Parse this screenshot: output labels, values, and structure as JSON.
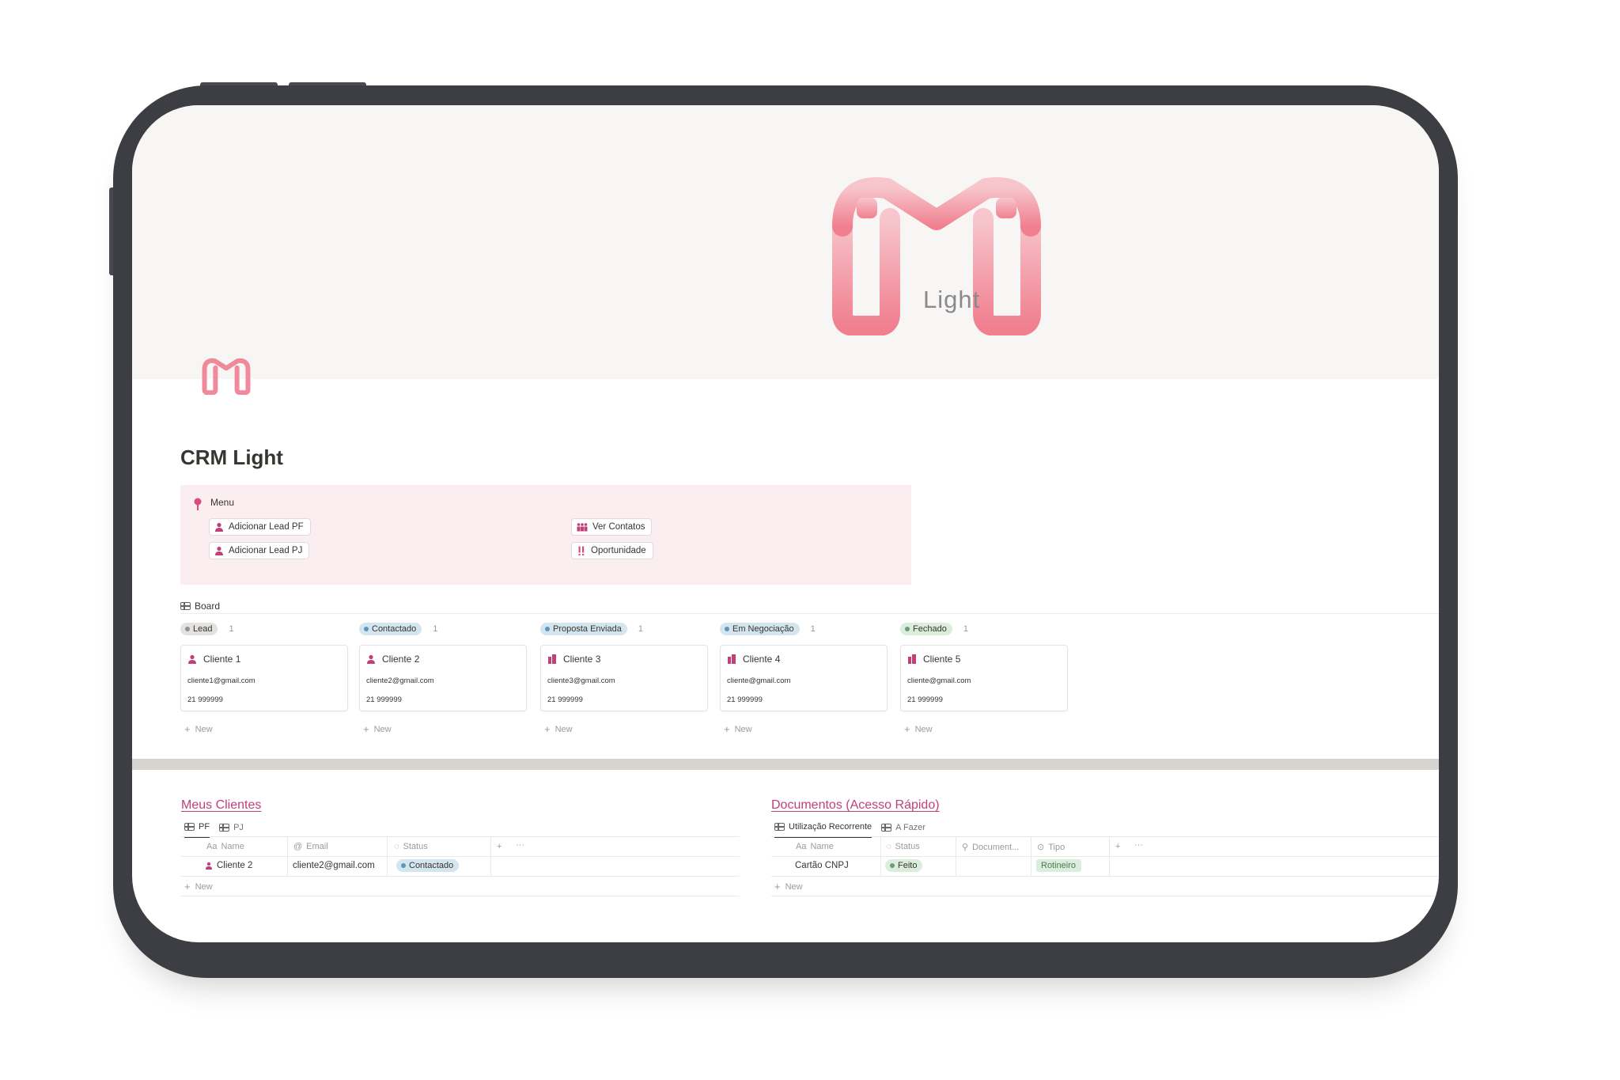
{
  "cover": {
    "logo_word": "Light"
  },
  "page": {
    "title": "CRM Light"
  },
  "callout": {
    "title": "Menu",
    "buttons": [
      {
        "label": "Adicionar Lead PF",
        "icon": "person-icon"
      },
      {
        "label": "Adicionar Lead PJ",
        "icon": "person-icon"
      },
      {
        "label": "Ver Contatos",
        "icon": "people-icon"
      },
      {
        "label": "Oportunidade",
        "icon": "exclamation-icon"
      }
    ]
  },
  "board": {
    "label": "Board",
    "new_label": "New",
    "columns": [
      {
        "status": "Lead",
        "count": "1",
        "color": "#e3e2e0",
        "dot": "#91918e",
        "card": {
          "name": "Cliente 1",
          "email": "cliente1@gmail.com",
          "phone": "21 999999",
          "icon": "person-icon"
        }
      },
      {
        "status": "Contactado",
        "count": "1",
        "color": "#d3e5ef",
        "dot": "#5b97bd",
        "card": {
          "name": "Cliente 2",
          "email": "cliente2@gmail.com",
          "phone": "21 999999",
          "icon": "person-icon"
        }
      },
      {
        "status": "Proposta Enviada",
        "count": "1",
        "color": "#d3e5ef",
        "dot": "#5b97bd",
        "card": {
          "name": "Cliente 3",
          "email": "cliente3@gmail.com",
          "phone": "21 999999",
          "icon": "building-icon"
        }
      },
      {
        "status": "Em Negociação",
        "count": "1",
        "color": "#d3e5ef",
        "dot": "#5b97bd",
        "card": {
          "name": "Cliente 4",
          "email": "cliente@gmail.com",
          "phone": "21 999999",
          "icon": "building-icon"
        }
      },
      {
        "status": "Fechado",
        "count": "1",
        "color": "#dbeddb",
        "dot": "#6c9b7d",
        "card": {
          "name": "Cliente 5",
          "email": "cliente@gmail.com",
          "phone": "21 999999",
          "icon": "building-icon"
        }
      }
    ]
  },
  "clientes": {
    "title": "Meus Clientes",
    "tabs": [
      "PF",
      "PJ"
    ],
    "headers": {
      "name": "Name",
      "email": "Email",
      "status": "Status"
    },
    "row": {
      "name": "Cliente 2",
      "email": "cliente2@gmail.com",
      "status": "Contactado"
    },
    "new_label": "New"
  },
  "documentos": {
    "title": "Documentos (Acesso Rápido)",
    "tabs": [
      "Utilização Recorrente",
      "A Fazer"
    ],
    "headers": {
      "name": "Name",
      "status": "Status",
      "document": "Document...",
      "tipo": "Tipo"
    },
    "row": {
      "name": "Cartão CNPJ",
      "status": "Feito",
      "tipo": "Rotineiro"
    },
    "new_label": "New"
  },
  "colors": {
    "accent": "#c0407a",
    "logo_pink": "#f08a9a"
  }
}
